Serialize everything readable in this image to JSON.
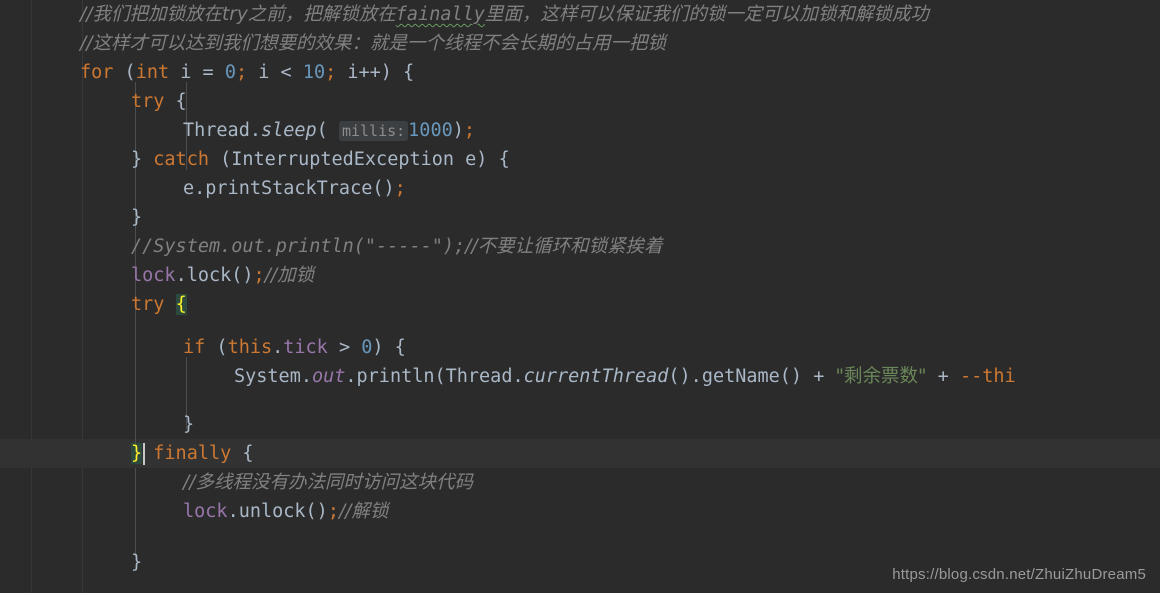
{
  "editor": {
    "background_color": "#2b2b2b",
    "default_text_color": "#a9b7c6",
    "caret_line_color": "#323232",
    "language": "Java",
    "colors": {
      "keyword": "#cc7832",
      "number": "#6897bb",
      "string": "#6a8759",
      "comment": "#808080",
      "field": "#9876aa",
      "identifier": "#a9b7c6",
      "brace_match_bg": "#2d4a3e",
      "brace_match_fg": "#ffef28",
      "inlay_hint_bg": "#3b3f41",
      "inlay_hint_fg": "#8c8c8c",
      "typo_squiggle": "#6a9a62",
      "indent_guide": "#4b4f52",
      "gutter_rule": "#353739"
    }
  },
  "code": {
    "line01": {
      "comment_a": "//我们把加锁放在try之前，把解锁放在",
      "typo": "fainally",
      "comment_b": "里面，这样可以保证我们的锁一定可以加锁和解锁成功"
    },
    "line02": {
      "comment": "//这样才可以达到我们想要的效果：就是一个线程不会长期的占用一把锁"
    },
    "line03": {
      "kw_for": "for",
      "open_paren": " (",
      "kw_int": "int",
      "var_i": " i ",
      "eq": "= ",
      "zero": "0",
      "semi1": ";",
      "cond": " i < ",
      "ten": "10",
      "semi2": ";",
      "incr": " i++) {"
    },
    "line04": {
      "kw_try": "try",
      "brace": " {"
    },
    "line05": {
      "cls": "Thread.",
      "method": "sleep",
      "open": "( ",
      "hint": "millis:",
      "value": "1000",
      "close": ")",
      "semi": ";"
    },
    "line06": {
      "close_brace": "} ",
      "kw_catch": "catch",
      "exception": " (InterruptedException e) {"
    },
    "line07": {
      "text": "e.printStackTrace()",
      "semi": ";"
    },
    "line08": {
      "text": "}"
    },
    "line09": {
      "comment_code": "//System.out.println(\"-----\")",
      "semi": ";",
      "comment_cn": "//不要让循环和锁紧挨着"
    },
    "line10": {
      "field": "lock",
      "call": ".lock()",
      "semi": ";",
      "comment": "//加锁"
    },
    "line11": {
      "kw_try": "try",
      "space": " ",
      "brace": "{"
    },
    "line13": {
      "kw_if": "if",
      "open": " (",
      "kw_this": "this",
      "dot": ".",
      "field": "tick",
      "op": " > ",
      "zero": "0",
      "close": ") {"
    },
    "line14": {
      "sys": "System.",
      "out": "out",
      "println": ".println(Thread.",
      "current": "currentThread",
      "getname": "().getName() ",
      "plus1": "+ ",
      "string": "\"剩余票数\"",
      "plus2": " + ",
      "tail": "--thi"
    },
    "line16": {
      "text": "}"
    },
    "line17": {
      "close_brace": "}",
      "kw_finally": " finally",
      "brace": " {"
    },
    "line18": {
      "comment": "//多线程没有办法同时访问这块代码"
    },
    "line19": {
      "field": "lock",
      "call": ".unlock()",
      "semi": ";",
      "comment": "//解锁"
    },
    "line21": {
      "text": "}"
    }
  },
  "watermark": {
    "url": "https://blog.csdn.net/ZhuiZhuDream5"
  }
}
